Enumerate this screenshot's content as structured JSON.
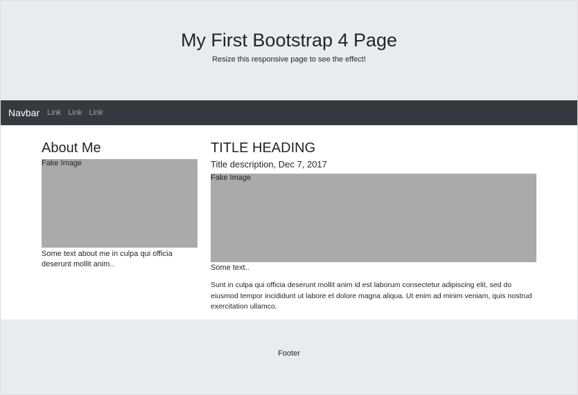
{
  "jumbotron": {
    "title": "My First Bootstrap 4 Page",
    "subtitle": "Resize this responsive page to see the effect!"
  },
  "navbar": {
    "brand": "Navbar",
    "links": [
      "Link",
      "Link",
      "Link"
    ]
  },
  "sidebar": {
    "heading": "About Me",
    "image_label": "Fake Image",
    "text": "Some text about me in culpa qui officia deserunt mollit anim.."
  },
  "main": {
    "heading": "TITLE HEADING",
    "description": "Title description, Dec 7, 2017",
    "image_label": "Fake Image",
    "short_text": "Some text..",
    "body_text": "Sunt in culpa qui officia deserunt mollit anim id est laborum consectetur adipiscing elit, sed do eiusmod tempor incididunt ut labore et dolore magna aliqua. Ut enim ad minim veniam, quis nostrud exercitation ullamco."
  },
  "footer": {
    "text": "Footer"
  },
  "colors": {
    "jumbotron_bg": "#e9ecef",
    "navbar_bg": "#343a40",
    "image_placeholder": "#aaaaaa"
  }
}
